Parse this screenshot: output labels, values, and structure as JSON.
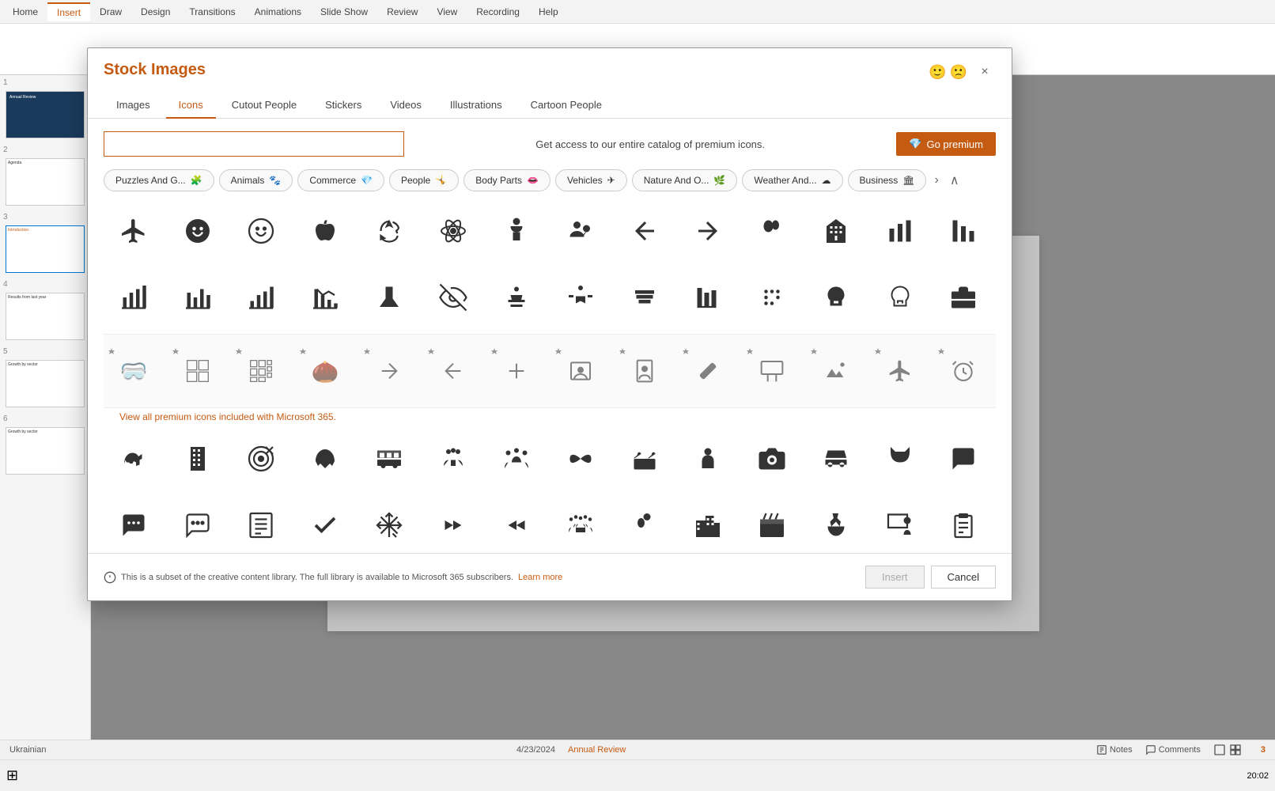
{
  "app": {
    "title": "Stock Images"
  },
  "ribbon": {
    "tabs": [
      "Home",
      "Insert",
      "Draw",
      "Design",
      "Transitions",
      "Animations",
      "Slide Show",
      "Review",
      "View",
      "Recording",
      "Help"
    ],
    "active_tab": "Insert"
  },
  "dialog": {
    "title": "Stock Images",
    "close_label": "×",
    "tabs": [
      "Images",
      "Icons",
      "Cutout People",
      "Stickers",
      "Videos",
      "Illustrations",
      "Cartoon People"
    ],
    "active_tab": "Icons",
    "search": {
      "placeholder": "",
      "label": "Get access to our entire catalog of premium icons.",
      "premium_button": "Go premium"
    },
    "categories": [
      "Puzzles And G...",
      "Animals",
      "Commerce",
      "People",
      "Body Parts",
      "Vehicles",
      "Nature And O...",
      "Weather And...",
      "Business"
    ],
    "premium_link": "View all premium icons included with Microsoft 365.",
    "footer": {
      "info": "This is a subset of the creative content library. The full library is available to Microsoft 365 subscribers.",
      "learn_more": "Learn more",
      "insert_btn": "Insert",
      "cancel_btn": "Cancel"
    }
  },
  "status_bar": {
    "language": "Ukrainian",
    "notes": "Notes",
    "comments": "Comments",
    "slide_info": "4/23/2024",
    "presentation_name": "Annual Review",
    "slide_number": "3"
  },
  "icons_row1": [
    "✈",
    "😊",
    "😊",
    "🍎",
    "🔄",
    "⚛",
    "👶",
    "🕵",
    "↩",
    "↪",
    "🎈",
    "🏛",
    "📊",
    "📊"
  ],
  "icons_row2": [
    "📊",
    "📊",
    "📊",
    "📊",
    "🧪",
    "👁",
    "💼",
    "🏋",
    "📚",
    "📊",
    "⬛",
    "🧠",
    "🧠",
    "💼"
  ],
  "icons_row3_premium": [
    "👓",
    "🎲",
    "🎲",
    "🌰",
    "→",
    "←",
    "✚",
    "👤",
    "📋",
    "🩹",
    "📺",
    "🌾",
    "✈",
    "⏰"
  ],
  "icons_row4": [
    "🦕",
    "🏢",
    "🎯",
    "🦅",
    "🚌",
    "👥",
    "👥",
    "🦋",
    "🎂",
    "👤",
    "📷",
    "🚗",
    "🐱",
    "💬"
  ],
  "icons_row5": [
    "💬",
    "💬",
    "📋",
    "✔",
    "❄",
    "»",
    "«",
    "👥",
    "🎈",
    "🏙",
    "🎬",
    "👏",
    "📋",
    "📋"
  ]
}
